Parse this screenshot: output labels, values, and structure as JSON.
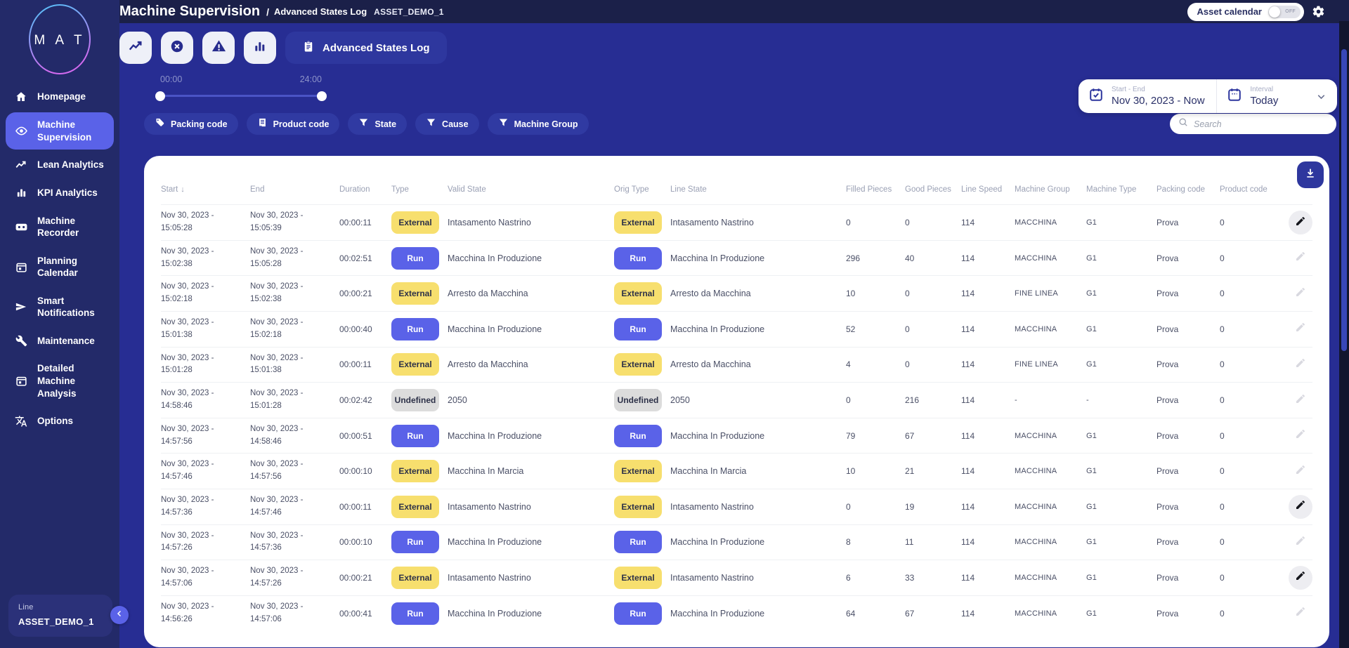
{
  "app": {
    "logo_text": "M A T",
    "title": "Machine Supervision",
    "breadcrumb_separator": "/",
    "breadcrumb": "Advanced States Log",
    "asset": "ASSET_DEMO_1"
  },
  "topbar": {
    "asset_calendar_label": "Asset calendar",
    "toggle_state": "OFF",
    "gear_icon": "gear-icon"
  },
  "sidebar": {
    "items": [
      {
        "label": "Homepage",
        "icon": "home-icon",
        "active": false
      },
      {
        "label": "Machine Supervision",
        "icon": "eye-icon",
        "active": true
      },
      {
        "label": "Lean Analytics",
        "icon": "trending-up-icon",
        "active": false
      },
      {
        "label": "KPI Analytics",
        "icon": "bar-chart-icon",
        "active": false
      },
      {
        "label": "Machine Recorder",
        "icon": "recorder-icon",
        "active": false
      },
      {
        "label": "Planning Calendar",
        "icon": "calendar-icon",
        "active": false
      },
      {
        "label": "Smart Notifications",
        "icon": "send-icon",
        "active": false
      },
      {
        "label": "Maintenance",
        "icon": "wrench-icon",
        "active": false
      },
      {
        "label": "Detailed Machine Analysis",
        "icon": "calendar-icon",
        "active": false
      },
      {
        "label": "Options",
        "icon": "translate-icon",
        "active": false
      }
    ],
    "line_panel": {
      "label": "Line",
      "value": "ASSET_DEMO_1"
    }
  },
  "toolbar": {
    "icons": [
      "line-chart-icon",
      "x-circle-icon",
      "warning-icon",
      "bar-chart-icon"
    ],
    "advanced_states_log_label": "Advanced States Log"
  },
  "time_slider": {
    "start_label": "00:00",
    "end_label": "24:00"
  },
  "date_panel": {
    "start_end_label": "Start - End",
    "start_end_value": "Nov 30, 2023 - Now",
    "interval_label": "Interval",
    "interval_value": "Today"
  },
  "filters": {
    "chips": [
      {
        "label": "Packing code",
        "icon": "tag-icon"
      },
      {
        "label": "Product code",
        "icon": "product-code-icon"
      },
      {
        "label": "State",
        "icon": "funnel-icon"
      },
      {
        "label": "Cause",
        "icon": "funnel-icon"
      },
      {
        "label": "Machine Group",
        "icon": "funnel-icon"
      }
    ],
    "search_placeholder": "Search"
  },
  "table": {
    "columns": [
      "Start",
      "End",
      "Duration",
      "Type",
      "Valid State",
      "Orig Type",
      "Line State",
      "Filled Pieces",
      "Good Pieces",
      "Line Speed",
      "Machine Group",
      "Machine Type",
      "Packing code",
      "Product code"
    ],
    "rows": [
      {
        "s1": "Nov 30, 2023 -",
        "s2": "15:05:28",
        "e1": "Nov 30, 2023 -",
        "e2": "15:05:39",
        "dur": "00:00:11",
        "type": "External",
        "valid": "Intasamento Nastrino",
        "orig": "External",
        "line": "Intasamento Nastrino",
        "filled": "0",
        "good": "0",
        "speed": "114",
        "group": "MACCHINA",
        "mtype": "G1",
        "pack": "Prova",
        "prod": "0",
        "edit_active": true
      },
      {
        "s1": "Nov 30, 2023 -",
        "s2": "15:02:38",
        "e1": "Nov 30, 2023 -",
        "e2": "15:05:28",
        "dur": "00:02:51",
        "type": "Run",
        "valid": "Macchina In Produzione",
        "orig": "Run",
        "line": "Macchina In Produzione",
        "filled": "296",
        "good": "40",
        "speed": "114",
        "group": "MACCHINA",
        "mtype": "G1",
        "pack": "Prova",
        "prod": "0",
        "edit_active": false
      },
      {
        "s1": "Nov 30, 2023 -",
        "s2": "15:02:18",
        "e1": "Nov 30, 2023 -",
        "e2": "15:02:38",
        "dur": "00:00:21",
        "type": "External",
        "valid": "Arresto da Macchina",
        "orig": "External",
        "line": "Arresto da Macchina",
        "filled": "10",
        "good": "0",
        "speed": "114",
        "group": "FINE LINEA",
        "mtype": "G1",
        "pack": "Prova",
        "prod": "0",
        "edit_active": false
      },
      {
        "s1": "Nov 30, 2023 -",
        "s2": "15:01:38",
        "e1": "Nov 30, 2023 -",
        "e2": "15:02:18",
        "dur": "00:00:40",
        "type": "Run",
        "valid": "Macchina In Produzione",
        "orig": "Run",
        "line": "Macchina In Produzione",
        "filled": "52",
        "good": "0",
        "speed": "114",
        "group": "MACCHINA",
        "mtype": "G1",
        "pack": "Prova",
        "prod": "0",
        "edit_active": false
      },
      {
        "s1": "Nov 30, 2023 -",
        "s2": "15:01:28",
        "e1": "Nov 30, 2023 -",
        "e2": "15:01:38",
        "dur": "00:00:11",
        "type": "External",
        "valid": "Arresto da Macchina",
        "orig": "External",
        "line": "Arresto da Macchina",
        "filled": "4",
        "good": "0",
        "speed": "114",
        "group": "FINE LINEA",
        "mtype": "G1",
        "pack": "Prova",
        "prod": "0",
        "edit_active": false
      },
      {
        "s1": "Nov 30, 2023 -",
        "s2": "14:58:46",
        "e1": "Nov 30, 2023 -",
        "e2": "15:01:28",
        "dur": "00:02:42",
        "type": "Undefined",
        "valid": "2050",
        "orig": "Undefined",
        "line": "2050",
        "filled": "0",
        "good": "216",
        "speed": "114",
        "group": "-",
        "mtype": "-",
        "pack": "Prova",
        "prod": "0",
        "edit_active": false
      },
      {
        "s1": "Nov 30, 2023 -",
        "s2": "14:57:56",
        "e1": "Nov 30, 2023 -",
        "e2": "14:58:46",
        "dur": "00:00:51",
        "type": "Run",
        "valid": "Macchina In Produzione",
        "orig": "Run",
        "line": "Macchina In Produzione",
        "filled": "79",
        "good": "67",
        "speed": "114",
        "group": "MACCHINA",
        "mtype": "G1",
        "pack": "Prova",
        "prod": "0",
        "edit_active": false
      },
      {
        "s1": "Nov 30, 2023 -",
        "s2": "14:57:46",
        "e1": "Nov 30, 2023 -",
        "e2": "14:57:56",
        "dur": "00:00:10",
        "type": "External",
        "valid": "Macchina In Marcia",
        "orig": "External",
        "line": "Macchina In Marcia",
        "filled": "10",
        "good": "21",
        "speed": "114",
        "group": "MACCHINA",
        "mtype": "G1",
        "pack": "Prova",
        "prod": "0",
        "edit_active": false
      },
      {
        "s1": "Nov 30, 2023 -",
        "s2": "14:57:36",
        "e1": "Nov 30, 2023 -",
        "e2": "14:57:46",
        "dur": "00:00:11",
        "type": "External",
        "valid": "Intasamento Nastrino",
        "orig": "External",
        "line": "Intasamento Nastrino",
        "filled": "0",
        "good": "19",
        "speed": "114",
        "group": "MACCHINA",
        "mtype": "G1",
        "pack": "Prova",
        "prod": "0",
        "edit_active": true
      },
      {
        "s1": "Nov 30, 2023 -",
        "s2": "14:57:26",
        "e1": "Nov 30, 2023 -",
        "e2": "14:57:36",
        "dur": "00:00:10",
        "type": "Run",
        "valid": "Macchina In Produzione",
        "orig": "Run",
        "line": "Macchina In Produzione",
        "filled": "8",
        "good": "11",
        "speed": "114",
        "group": "MACCHINA",
        "mtype": "G1",
        "pack": "Prova",
        "prod": "0",
        "edit_active": false
      },
      {
        "s1": "Nov 30, 2023 -",
        "s2": "14:57:06",
        "e1": "Nov 30, 2023 -",
        "e2": "14:57:26",
        "dur": "00:00:21",
        "type": "External",
        "valid": "Intasamento Nastrino",
        "orig": "External",
        "line": "Intasamento Nastrino",
        "filled": "6",
        "good": "33",
        "speed": "114",
        "group": "MACCHINA",
        "mtype": "G1",
        "pack": "Prova",
        "prod": "0",
        "edit_active": true
      },
      {
        "s1": "Nov 30, 2023 -",
        "s2": "14:56:26",
        "e1": "Nov 30, 2023 -",
        "e2": "14:57:06",
        "dur": "00:00:41",
        "type": "Run",
        "valid": "Macchina In Produzione",
        "orig": "Run",
        "line": "Macchina In Produzione",
        "filled": "64",
        "good": "67",
        "speed": "114",
        "group": "MACCHINA",
        "mtype": "G1",
        "pack": "Prova",
        "prod": "0",
        "edit_active": false
      }
    ]
  },
  "colors": {
    "accent": "#5a62e8",
    "badge_external": "#f7df6e",
    "badge_run": "#5a62e8",
    "badge_undefined": "#dcdcdc",
    "bg_main": "#272d93",
    "bg_sidebar": "#232a69",
    "bg_topbar": "#1b2049"
  }
}
